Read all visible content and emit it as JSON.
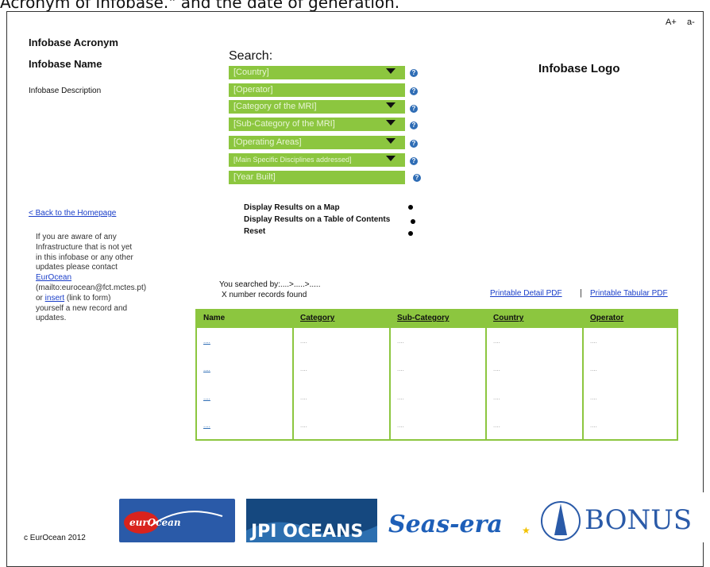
{
  "top_caption": "Acronym of Infobase.\" and the date of generation.",
  "font_controls": {
    "increase": "A+",
    "decrease": "a-"
  },
  "infobase": {
    "acronym": "Infobase Acronym",
    "name": "Infobase Name",
    "description": "Infobase Description",
    "logo_placeholder": "Infobase Logo"
  },
  "search": {
    "label": "Search:",
    "fields": [
      {
        "label": "[Country]",
        "has_dropdown": true
      },
      {
        "label": "[Operator]",
        "has_dropdown": false
      },
      {
        "label": "[Category of the MRI]",
        "has_dropdown": true
      },
      {
        "label": "[Sub-Category of the MRI]",
        "has_dropdown": true
      },
      {
        "label": "[Operating Areas]",
        "has_dropdown": true
      },
      {
        "label": "[Main Specific Disciplines addressed]",
        "has_dropdown": true
      },
      {
        "label": "[Year Built]",
        "has_dropdown": false
      }
    ],
    "help_glyph": "?"
  },
  "display_options": [
    "Display Results on a Map",
    "Display Results on a Table of Contents",
    "Reset"
  ],
  "sidebar": {
    "back_link": "< Back to the Homepage",
    "note_before_link1": "If you are aware of any Infrastructure that is not yet in this infobase or any other updates please contact ",
    "link1": "EurOcean",
    "note_mid": " (mailto:eurocean@fct.mctes.pt) or ",
    "link2": "insert",
    "note_after": " (link to form) yourself a new record and updates."
  },
  "results": {
    "searched_by": "You searched by:....>.....>.....",
    "records_found": "X number records found",
    "pdf_detail": "Printable Detail PDF",
    "separator": "|",
    "pdf_tabular": "Printable Tabular PDF",
    "columns": [
      "Name",
      "Category",
      "Sub-Category",
      "Country",
      "Operator"
    ],
    "rows": [
      [
        "....",
        "....",
        "....",
        "....",
        "...."
      ],
      [
        "....",
        "....",
        "....",
        "....",
        "...."
      ],
      [
        "....",
        "....",
        "....",
        "....",
        "...."
      ],
      [
        "....",
        "....",
        "....",
        "....",
        "...."
      ]
    ]
  },
  "partner_logos": [
    "eurOcean",
    "JPI OCEANS",
    "Seas-era",
    "BONUS"
  ],
  "footer": {
    "copyright": "c EurOcean 2012"
  },
  "colors": {
    "accent_green": "#8cc63f",
    "help_blue": "#2f6db5",
    "link_blue": "#1a3ec9"
  }
}
